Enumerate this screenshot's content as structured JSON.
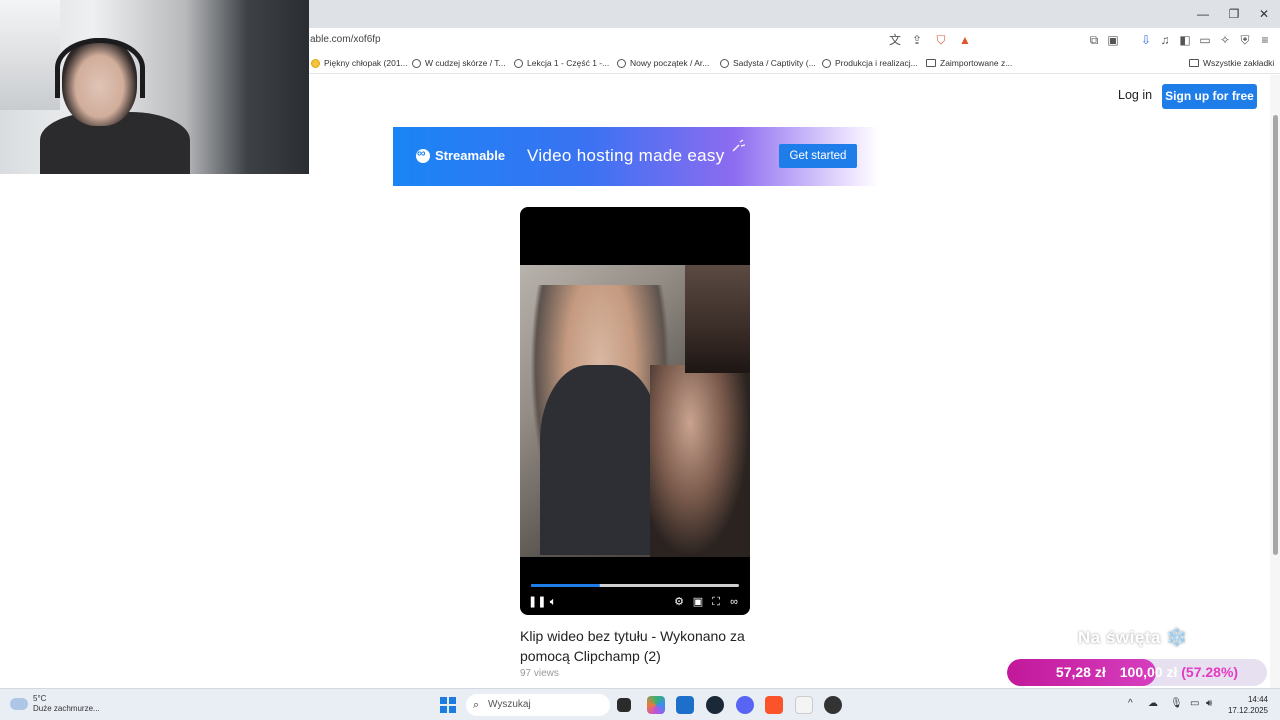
{
  "browser": {
    "url": "able.com/xof6fp",
    "bookmarks": [
      "Piękny chłopak (201...",
      "W cudzej skórze / T...",
      "Lekcja 1 - Część 1 -...",
      "Nowy początek / Ar...",
      "Sadysta / Captivity (...",
      "Produkcja i realizacj...",
      "Zaimportowane z..."
    ],
    "all_bookmarks": "Wszystkie zakładki"
  },
  "header": {
    "login": "Log in",
    "signup": "Sign up for free"
  },
  "banner": {
    "brand": "Streamable",
    "tagline": "Video hosting made easy",
    "cta": "Get started"
  },
  "video": {
    "title": "Klip wideo bez tytułu - Wykonano za pomocą Clipchamp (2)",
    "views": "97 views",
    "progress_fraction": 0.33
  },
  "overlay": {
    "goal_label": "Na święta ❄️",
    "goal_current": "57,28 zł",
    "goal_target": "100,00 zł",
    "goal_percent": "(57.28%)",
    "goal_fraction": 0.5728
  },
  "taskbar": {
    "weather_temp": "5°C",
    "weather_desc": "Duże zachmurze...",
    "search_placeholder": "Wyszukaj",
    "time": "14:44",
    "date": "17.12.2025"
  },
  "colors": {
    "accent": "#1f7dea",
    "goal_fill": "#c2189a"
  }
}
